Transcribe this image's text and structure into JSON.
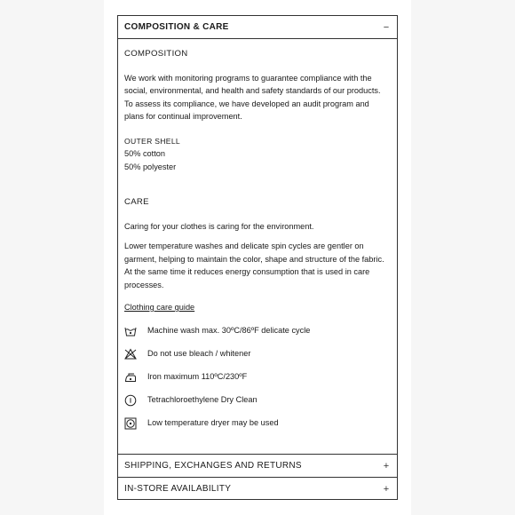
{
  "composition_care": {
    "title": "COMPOSITION & CARE",
    "toggle": "−",
    "composition": {
      "heading": "COMPOSITION",
      "paragraph": "We work with monitoring programs to guarantee compliance with the social, environmental, and health and safety standards of our products. To assess its compliance, we have developed an audit program and plans for continual improvement.",
      "outer_shell_label": "OUTER SHELL",
      "materials": [
        "50% cotton",
        "50% polyester"
      ]
    },
    "care": {
      "heading": "CARE",
      "paragraph1": "Caring for your clothes is caring for the environment.",
      "paragraph2": "Lower temperature washes and delicate spin cycles are gentler on garment, helping to maintain the color, shape and structure of the fabric. At the same time it reduces energy consumption that is used in care processes.",
      "guide_link": "Clothing care guide",
      "instructions": [
        {
          "icon": "wash-tub-icon",
          "text": "Machine wash max. 30ºC/86ºF delicate cycle"
        },
        {
          "icon": "no-bleach-icon",
          "text": "Do not use bleach / whitener"
        },
        {
          "icon": "iron-icon",
          "text": "Iron maximum 110ºC/230ºF"
        },
        {
          "icon": "dry-clean-icon",
          "text": "Tetrachloroethylene Dry Clean"
        },
        {
          "icon": "tumble-dry-icon",
          "text": "Low temperature dryer may be used"
        }
      ]
    }
  },
  "shipping": {
    "title": "SHIPPING, EXCHANGES AND RETURNS",
    "toggle": "+"
  },
  "store": {
    "title": "IN-STORE AVAILABILITY",
    "toggle": "+"
  }
}
